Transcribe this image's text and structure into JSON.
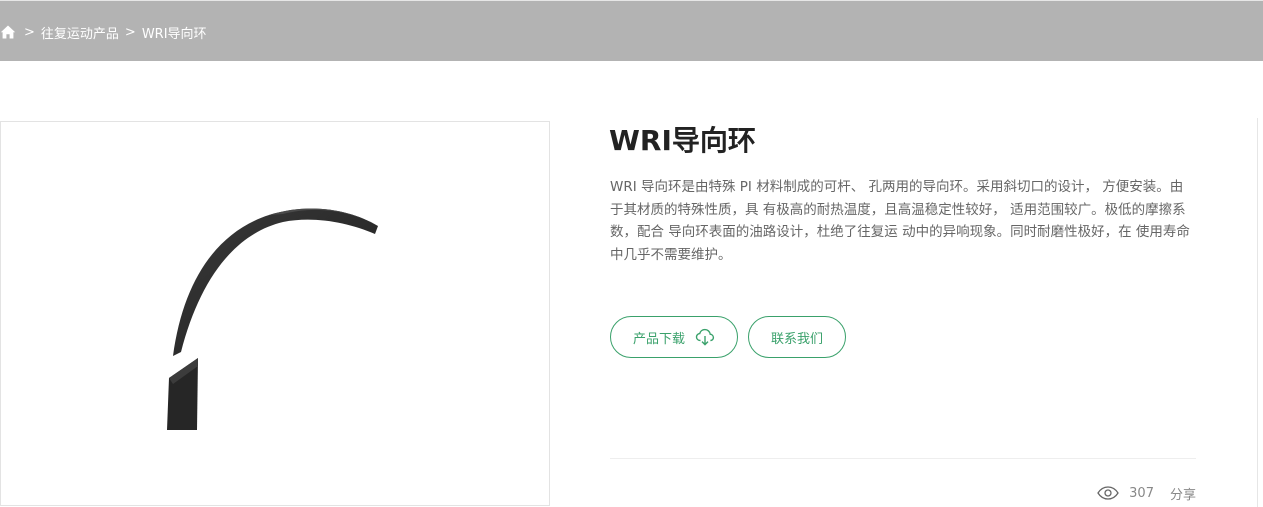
{
  "breadcrumb": {
    "separator": ">",
    "items": [
      "往复运动产品",
      "WRI导向环"
    ]
  },
  "product": {
    "image_alt": "WRI导向环 product image",
    "title": "WRI导向环",
    "description": "WRI 导向环是由特殊 PI 材料制成的可杆、 孔两用的导向环。采用斜切口的设计， 方便安装。由于其材质的特殊性质，具 有极高的耐热温度，且高温稳定性较好， 适用范围较广。极低的摩擦系数，配合 导向环表面的油路设计，杜绝了往复运 动中的异响现象。同时耐磨性极好，在 使用寿命中几乎不需要维护。"
  },
  "actions": {
    "download_label": "产品下载",
    "contact_label": "联系我们"
  },
  "stats": {
    "views": "307",
    "share_label": "分享"
  },
  "colors": {
    "topbar": "#b3b3b3",
    "accent": "#3aa16b",
    "text_dark": "#222222",
    "text_muted": "#666666"
  },
  "icons": {
    "home": "home-icon",
    "download": "cloud-download-icon",
    "views": "eye-icon"
  }
}
